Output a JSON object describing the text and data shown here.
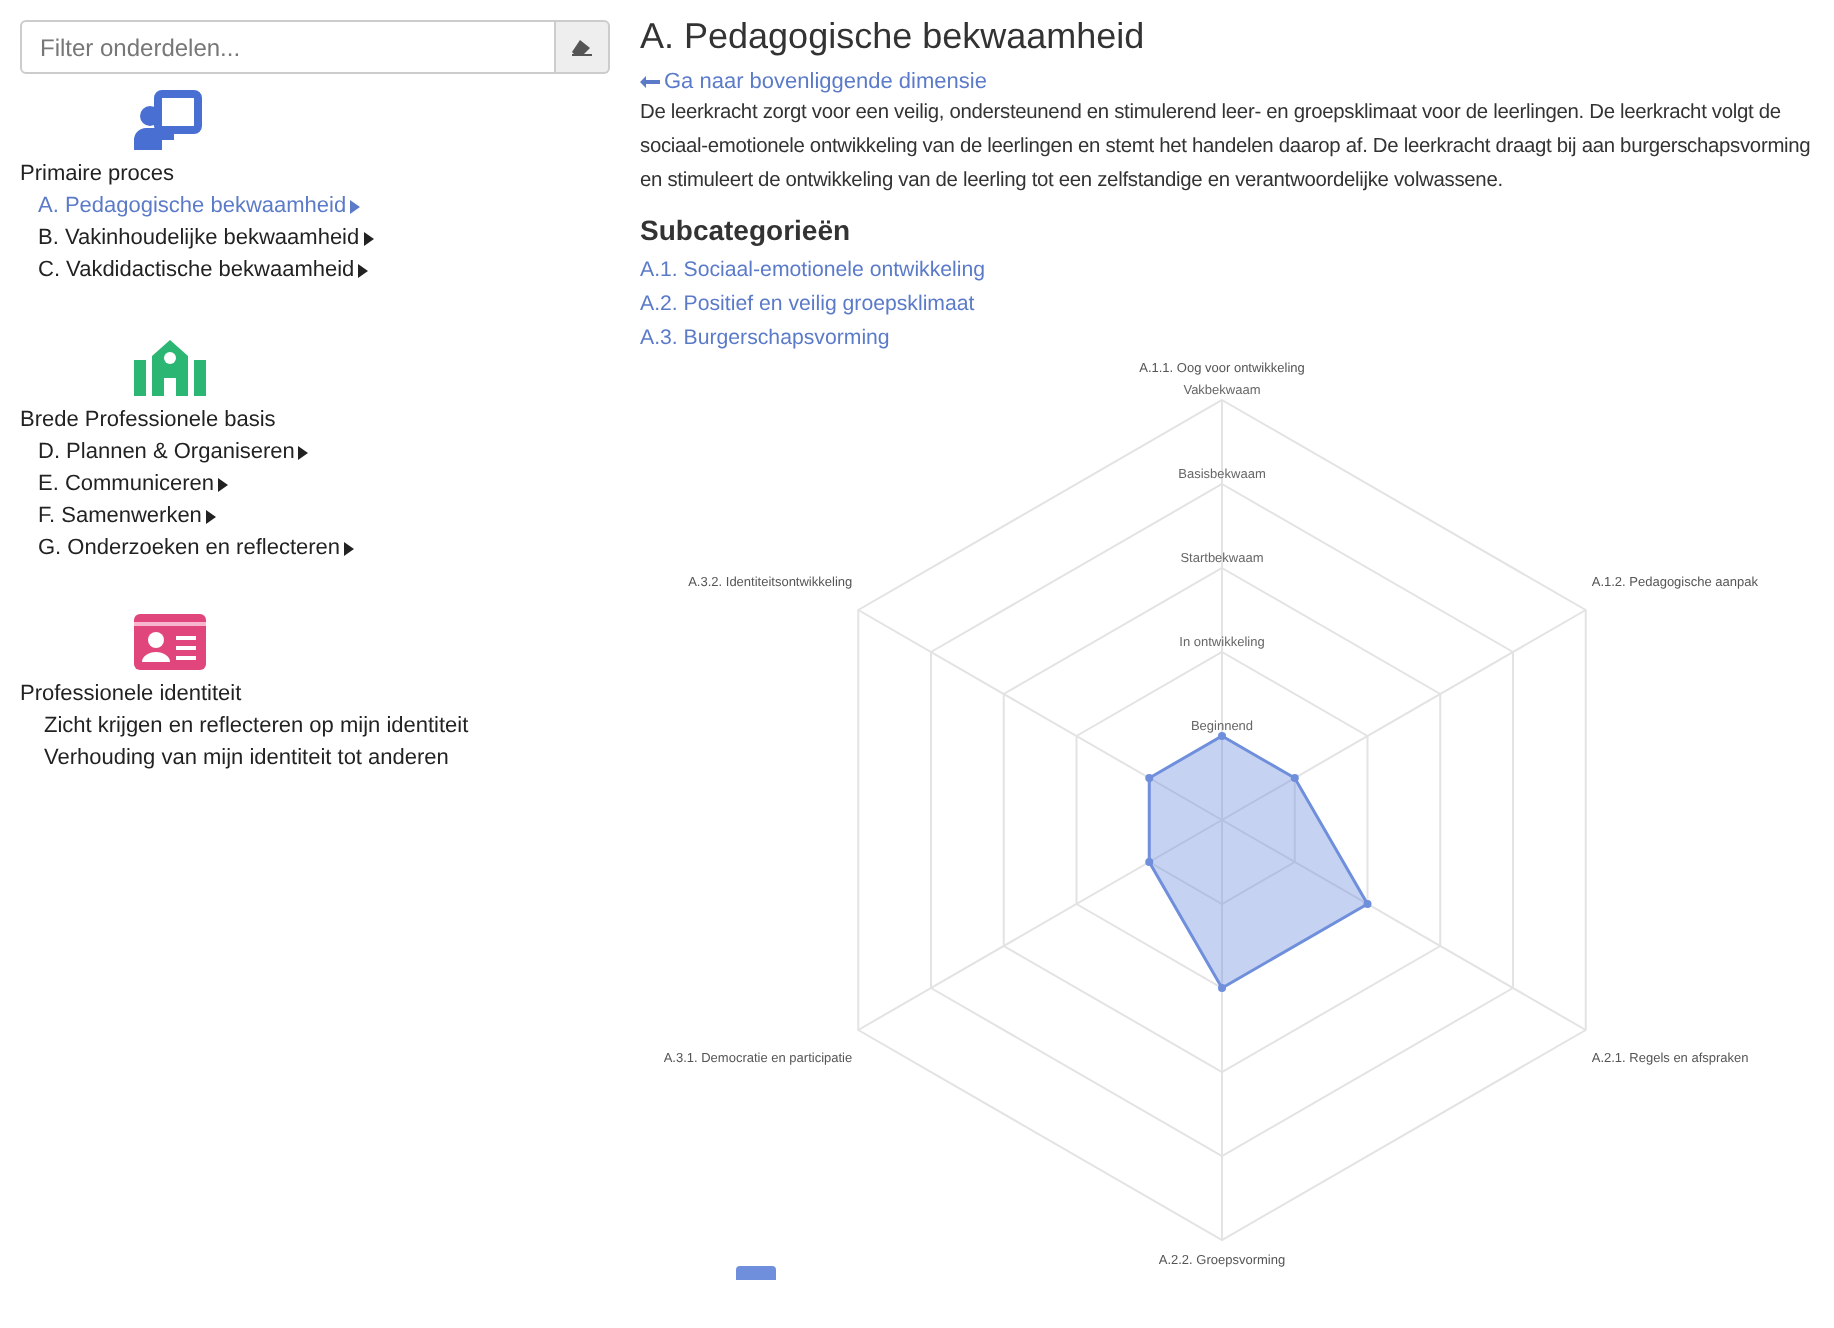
{
  "sidebar": {
    "filter": {
      "placeholder": "Filter onderdelen..."
    },
    "groups": [
      {
        "kind": "presentation",
        "title": "Primaire proces",
        "items": [
          {
            "label": "A. Pedagogische bekwaamheid",
            "selected": true,
            "expandable": true
          },
          {
            "label": "B. Vakinhoudelijke bekwaamheid",
            "selected": false,
            "expandable": true
          },
          {
            "label": "C. Vakdidactische bekwaamheid",
            "selected": false,
            "expandable": true
          }
        ]
      },
      {
        "kind": "school",
        "title": "Brede Professionele basis",
        "items": [
          {
            "label": "D. Plannen & Organiseren",
            "selected": false,
            "expandable": true
          },
          {
            "label": "E. Communiceren",
            "selected": false,
            "expandable": true
          },
          {
            "label": "F. Samenwerken",
            "selected": false,
            "expandable": true
          },
          {
            "label": "G. Onderzoeken en reflecteren",
            "selected": false,
            "expandable": true
          }
        ]
      },
      {
        "kind": "idcard",
        "title": "Professionele identiteit",
        "items": [
          {
            "label": "Zicht krijgen en reflecteren op mijn identiteit",
            "selected": false,
            "expandable": false
          },
          {
            "label": "Verhouding van mijn identiteit tot anderen",
            "selected": false,
            "expandable": false
          }
        ]
      }
    ]
  },
  "main": {
    "title": "A. Pedagogische bekwaamheid",
    "back_link": "Ga naar bovenliggende dimensie",
    "description": "De leerkracht zorgt voor een veilig, ondersteunend en stimulerend leer- en groepsklimaat voor de leerlingen. De leerkracht volgt de sociaal-emotionele ontwikkeling van de leerlingen en stemt het handelen daarop af. De leerkracht draagt bij aan burgerschapsvorming en stimuleert de ontwikkeling van de leerling tot een zelfstandige en verantwoordelijke volwassene.",
    "subcategories_heading": "Subcategorieën",
    "subcategories": [
      "A.1. Sociaal-emotionele ontwikkeling",
      "A.2. Positief en veilig groepsklimaat",
      "A.3. Burgerschapsvorming"
    ],
    "chart_data": {
      "type": "radar",
      "categories": [
        "A.1.1. Oog voor ontwikkeling",
        "A.1.2. Pedagogische aanpak",
        "A.2.1. Regels en afspraken",
        "A.2.2. Groepsvorming",
        "A.3.1. Democratie en participatie",
        "A.3.2. Identiteitsontwikkeling"
      ],
      "series": [
        {
          "color": "#6f8fdc",
          "values": [
            1,
            1,
            2,
            2,
            1,
            1
          ]
        }
      ],
      "ylim": [
        0,
        5
      ],
      "yticks": [
        {
          "value": 1,
          "label": "Beginnend"
        },
        {
          "value": 2,
          "label": "In ontwikkeling"
        },
        {
          "value": 3,
          "label": "Startbekwaam"
        },
        {
          "value": 4,
          "label": "Basisbekwaam"
        },
        {
          "value": 5,
          "label": "Vakbekwaam"
        }
      ]
    }
  }
}
